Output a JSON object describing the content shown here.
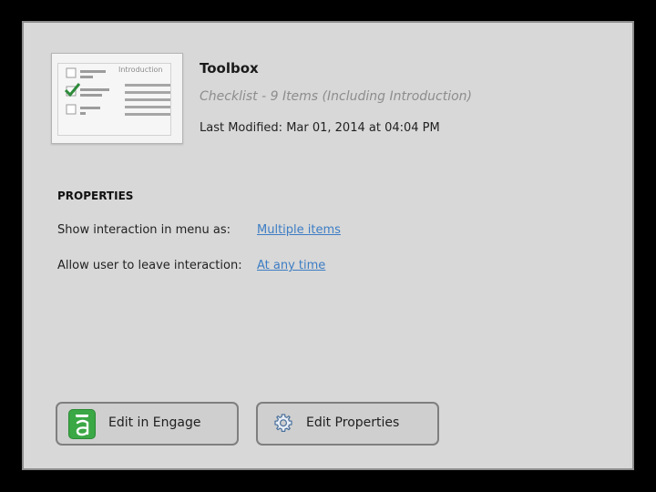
{
  "thumbnail": {
    "label": "Introduction",
    "checkbox_checked_color": "#2e8b3a"
  },
  "header": {
    "title": "Toolbox",
    "subtitle": "Checklist - 9 Items (Including Introduction)",
    "last_modified": "Last Modified: Mar 01, 2014 at 04:04 PM"
  },
  "properties": {
    "heading": "PROPERTIES",
    "items": [
      {
        "label": "Show interaction in menu as:",
        "value": "Multiple items"
      },
      {
        "label": "Allow user to leave interaction:",
        "value": "At any time"
      }
    ]
  },
  "buttons": {
    "edit_engage": {
      "label": "Edit in Engage",
      "icon": "engage-logo-icon"
    },
    "edit_properties": {
      "label": "Edit Properties",
      "icon": "gear-icon"
    }
  },
  "colors": {
    "link": "#3d7dc4",
    "engage_green": "#3aa845",
    "panel_bg": "#d8d8d8"
  }
}
